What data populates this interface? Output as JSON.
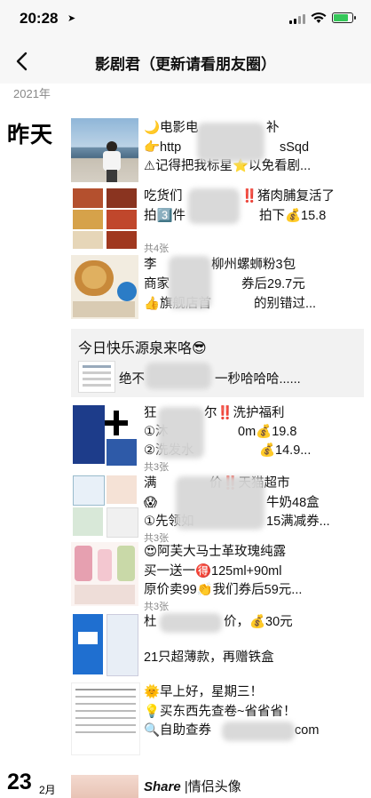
{
  "status": {
    "time": "20:28",
    "battery_color": "#35c759"
  },
  "nav": {
    "title": "影剧君（更新请看朋友圈）"
  },
  "timeline": {
    "year": "2021年",
    "day_label": "昨天",
    "posts": [
      {
        "lines": [
          "🌙电影电",
          "👉http",
          "⚠记得把我标星⭐以免看剧..."
        ],
        "lines_extra": [
          "补",
          "sSqd"
        ]
      },
      {
        "lines": [
          "吃货们",
          "拍3️⃣件",
          "共4张"
        ],
        "lines_extra": [
          "‼️猪肉脯复活了",
          "拍下💰15.8"
        ]
      },
      {
        "lines": [
          "李",
          "商家",
          "👍旗舰店首"
        ],
        "lines_extra": [
          "柳州螺蛳粉3包",
          "券后29.7元",
          "的别错过..."
        ]
      },
      {
        "share_title": "今日快乐源泉来咯😎",
        "share_text": "绝不",
        "share_text_end": "一秒哈哈哈......"
      },
      {
        "lines": [
          "狂",
          "①沐",
          "②洗发水",
          "共3张"
        ],
        "lines_extra": [
          "尔‼️洗护福利",
          "0m💰19.8",
          "💰14.9..."
        ]
      },
      {
        "lines": [
          "满",
          "😱",
          "①先领如",
          "共3张"
        ],
        "lines_extra": [
          "价‼️天猫超市",
          "牛奶48盒",
          "15满减券..."
        ]
      },
      {
        "lines": [
          "😍阿芙大马士革玫瑰纯露",
          "买一送一🉐125ml+90ml",
          "原价卖99👏我们券后59元...",
          "共3张"
        ]
      },
      {
        "lines": [
          "杜",
          "21只超薄款，再赠铁盒"
        ],
        "lines_extra": [
          "价，💰30元"
        ]
      },
      {
        "lines": [
          "🌞早上好，星期三！",
          "💡买东西先查卷~省省省！",
          "🔍自助查券"
        ],
        "lines_extra": [
          "com"
        ]
      }
    ],
    "footer": {
      "day": "23",
      "month": "2月",
      "text_italic": "Share",
      "text": "|情侣头像"
    }
  }
}
